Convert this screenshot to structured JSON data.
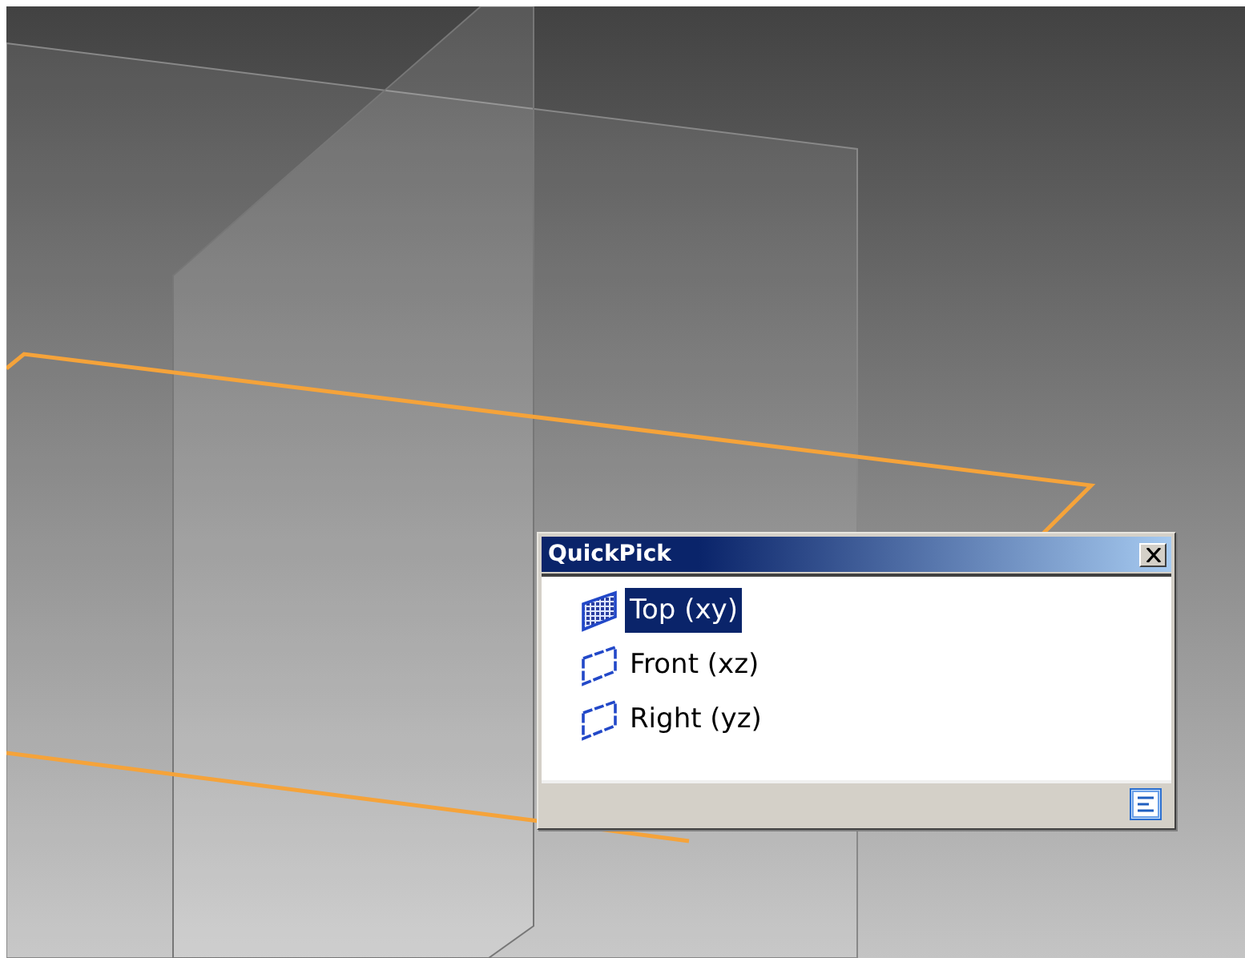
{
  "dialog": {
    "title": "QuickPick",
    "items": [
      {
        "label": "Top (xy)",
        "selected": true
      },
      {
        "label": "Front (xz)",
        "selected": false
      },
      {
        "label": "Right (yz)",
        "selected": false
      }
    ]
  }
}
